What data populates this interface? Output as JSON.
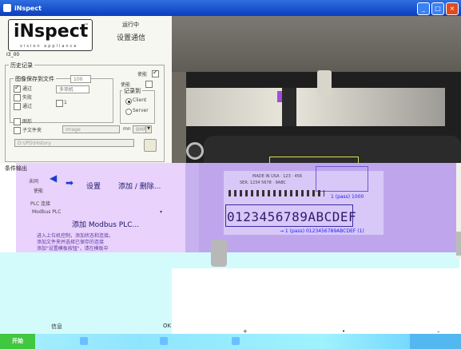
{
  "window": {
    "title": "iNspect"
  },
  "header": {
    "logo_word": "iNspect",
    "logo_tm": "™",
    "logo_tagline": "vision appliance",
    "status": "运行中",
    "settings_comm": "设置通信"
  },
  "device_id": "I3_00",
  "history": {
    "title": "历史记录",
    "enable_label": "使能",
    "save_group_title": "图像保存到文件",
    "save_count": "100",
    "pass_label": "通过",
    "fail_label": "失败",
    "num_field": "多项机",
    "value_1": "1",
    "image_label": "图形",
    "subfolder_label": "子文件夹",
    "subfolder_value": "Image",
    "mn_label": "mn",
    "bmp_value": "BMP",
    "path_value": "D:\\iPD\\History",
    "enable2_label": "使能",
    "record_to_label": "记录到",
    "client_label": "Client",
    "server_label": "Server"
  },
  "output": {
    "title": "条件输出",
    "item1": "未同",
    "item2": "使能",
    "settings_label": "设置",
    "add_remove_label": "添加 / 删除...",
    "output_conn": "PLC 连接",
    "output_plc": "Modbus PLC",
    "add_modbus": "添加 Modbus PLC...",
    "desc1": "进入上位机控制，添加状态和连接。",
    "desc2": "添加文件夹并选择已保存的连接",
    "desc3": "添加\"设置模板按钮\"，请在模板中",
    "info_label": "信息",
    "ok_label": "OK",
    "plus": "+",
    "bullet": "•",
    "minus": "–"
  },
  "ocr": {
    "string": "0123456789ABCDEF",
    "small1": "MADE IN USA · 123 · 456",
    "small2": "SER. 1234 5678 · 9ABC",
    "label1": "1 (pass) 1000",
    "label2": "→ 1 (pass) 0123456789ABCDEF (1)"
  },
  "taskbar": {
    "start": "开始",
    "clock": ""
  },
  "colors": {
    "titlebar": "#0a3dbd",
    "mid_purple": "#e9d2fb",
    "right_purple": "#c7b2ef",
    "bottom_cyan": "#d4fbfb"
  }
}
